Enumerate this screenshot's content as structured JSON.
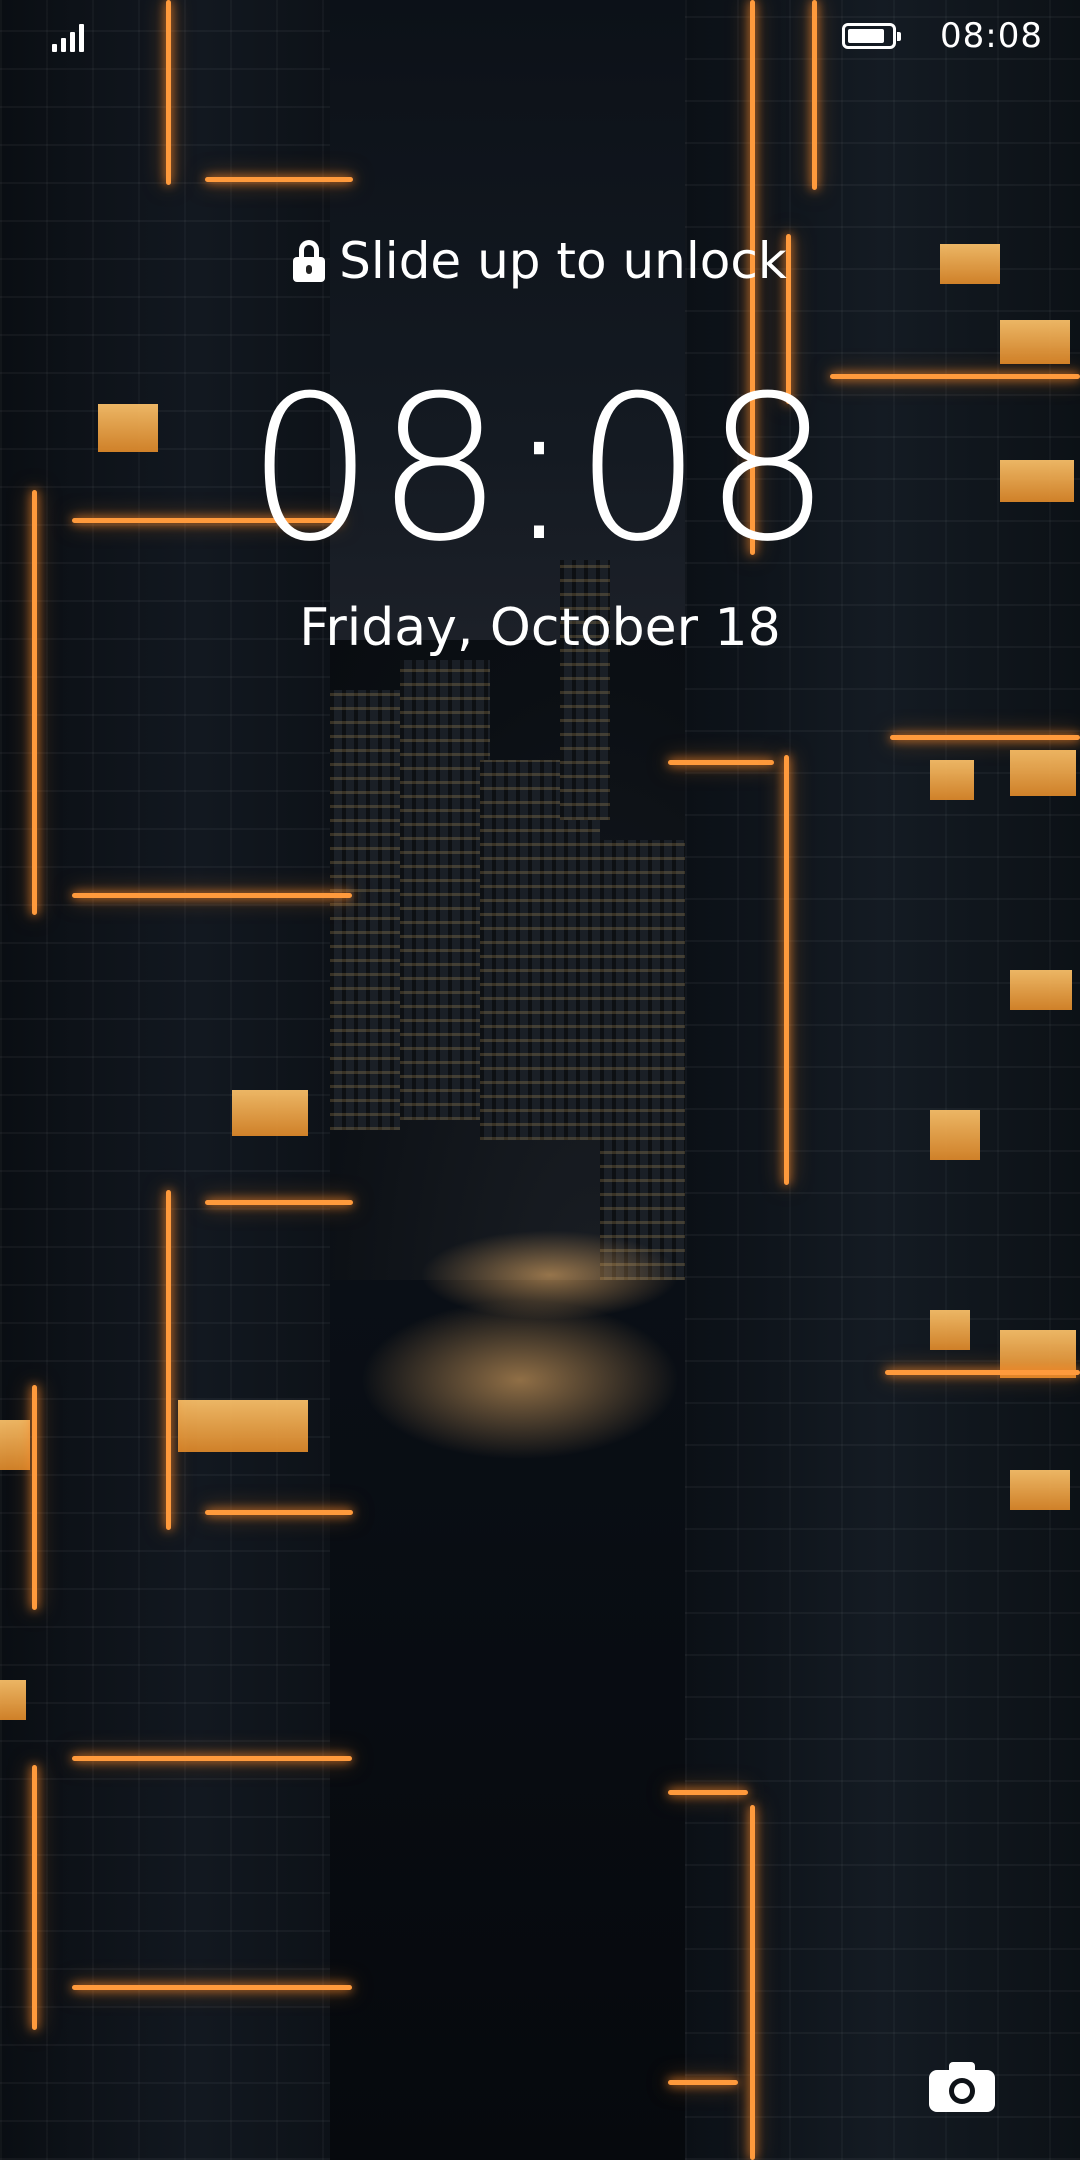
{
  "status_bar": {
    "time": "08:08",
    "signal_icon": "signal-strength-icon",
    "battery_icon": "battery-icon",
    "battery_level": 0.85
  },
  "lock_screen": {
    "unlock_hint": "Slide up to unlock",
    "lock_icon": "lock-icon",
    "clock": "08:08",
    "date": "Friday, October 18",
    "camera_icon": "camera-icon"
  },
  "wallpaper": {
    "description_icon": "city-night-wallpaper",
    "accent_color": "#ff9a3c"
  }
}
